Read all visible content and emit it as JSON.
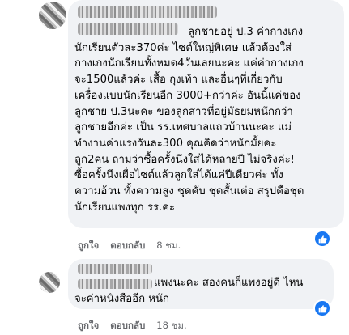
{
  "comments": [
    {
      "text": "ลูกชายอยู่ ป.3 ค่ากางเกง\nนักเรียนตัวละ370ค่ะ ไซต์ใหญ่พิเศษ แล้วต้องใส่\nกางเกงนักเรียนทั้งหมด4วันเลยนะคะ แค่ค่ากางเกง\nจะ1500แล้วค่ะ เสื้อ ถุงเท้า และอื่นๆที่เกี่ยวกับ\nเครื่องแบบนักเรียนอีก 3000+กว่าค่ะ อันนี้แค่ของ\nลูกชาย ป.3นะคะ ของลูกสาวที่อยู่มัธยมหนักกว่า\nลูกชายอีกค่ะ เป็น รร.เทศบาลแถวบ้านนะคะ แม่\nทำงานค่าแรงวันละ300 คุณคิดว่าหนักมั้ยคะ\nลูก2คน ถามว่าซื้อครั้งนึงใส่ได้หลายปี ไม่จริงค่ะ!\nซื้อครั้งนึงเผื่อไซต์แล้วลูกใส่ได้แค่ปีเดียวค่ะ ทั้ง\nความอ้วน ทั้งความสูง ชุดคับ ชุดสั้นเต่อ สรุปคือชุด\nนักเรียนแพงทุก รร.ค่ะ",
      "like_label": "ถูกใจ",
      "reply_label": "ตอบกลับ",
      "time": "8 ชม."
    },
    {
      "text": "แพงนะคะ สองคนก็แพงอยู่ดี ไหน\nจะค่าหนังสืออีก หนัก",
      "like_label": "ถูกใจ",
      "reply_label": "ตอบกลับ",
      "time": "18 ชม."
    }
  ],
  "icons": {
    "reaction": "like-thumb-icon"
  },
  "colors": {
    "bubble": "#f0f2f5",
    "meta": "#65676b",
    "like": "#1877f2"
  }
}
